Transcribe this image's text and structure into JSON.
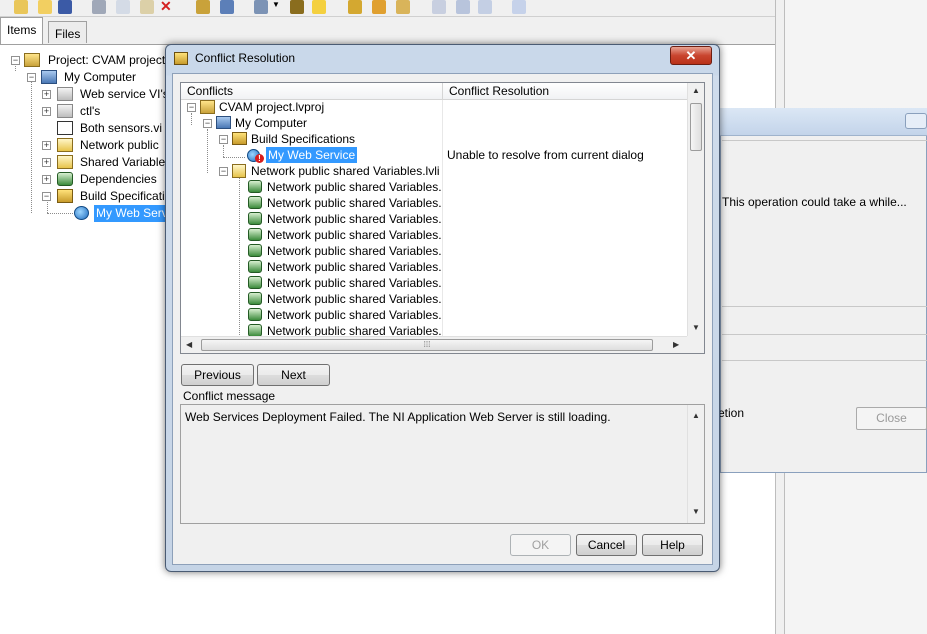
{
  "project_window": {
    "tabs": [
      {
        "label": "Items"
      },
      {
        "label": "Files"
      }
    ],
    "tree": [
      {
        "label": "Project: CVAM project"
      },
      {
        "label": "My Computer"
      },
      {
        "label": "Web service VI's"
      },
      {
        "label": "ctl's"
      },
      {
        "label": "Both sensors.vi"
      },
      {
        "label": "Network public"
      },
      {
        "label": "Shared Variables"
      },
      {
        "label": "Dependencies"
      },
      {
        "label": "Build Specificatio"
      },
      {
        "label": "My Web Servi"
      }
    ]
  },
  "back_dialog": {
    "message": "This operation could take a while...",
    "option_label": "etion",
    "close_label": "Close"
  },
  "dialog": {
    "title": "Conflict Resolution",
    "close_glyph": "✕",
    "columns": {
      "conflicts": "Conflicts",
      "resolution": "Conflict Resolution"
    },
    "tree": [
      {
        "label": "CVAM project.lvproj",
        "resolution": ""
      },
      {
        "label": "My Computer",
        "resolution": ""
      },
      {
        "label": "Build Specifications",
        "resolution": ""
      },
      {
        "label": "My Web Service",
        "resolution": "Unable to resolve from current dialog"
      },
      {
        "label": "Network public shared Variables.lvli",
        "resolution": ""
      },
      {
        "label": "Network public shared Variables.",
        "resolution": ""
      },
      {
        "label": "Network public shared Variables.",
        "resolution": ""
      },
      {
        "label": "Network public shared Variables.",
        "resolution": ""
      },
      {
        "label": "Network public shared Variables.",
        "resolution": ""
      },
      {
        "label": "Network public shared Variables.",
        "resolution": ""
      },
      {
        "label": "Network public shared Variables.",
        "resolution": ""
      },
      {
        "label": "Network public shared Variables.",
        "resolution": ""
      },
      {
        "label": "Network public shared Variables.",
        "resolution": ""
      },
      {
        "label": "Network public shared Variables.",
        "resolution": ""
      },
      {
        "label": "Network public shared Variables.",
        "resolution": ""
      }
    ],
    "previous_label": "Previous",
    "next_label": "Next",
    "message_heading": "Conflict message",
    "message_text": "Web Services Deployment Failed. The NI Application Web Server is still loading.",
    "ok_label": "OK",
    "cancel_label": "Cancel",
    "help_label": "Help"
  }
}
